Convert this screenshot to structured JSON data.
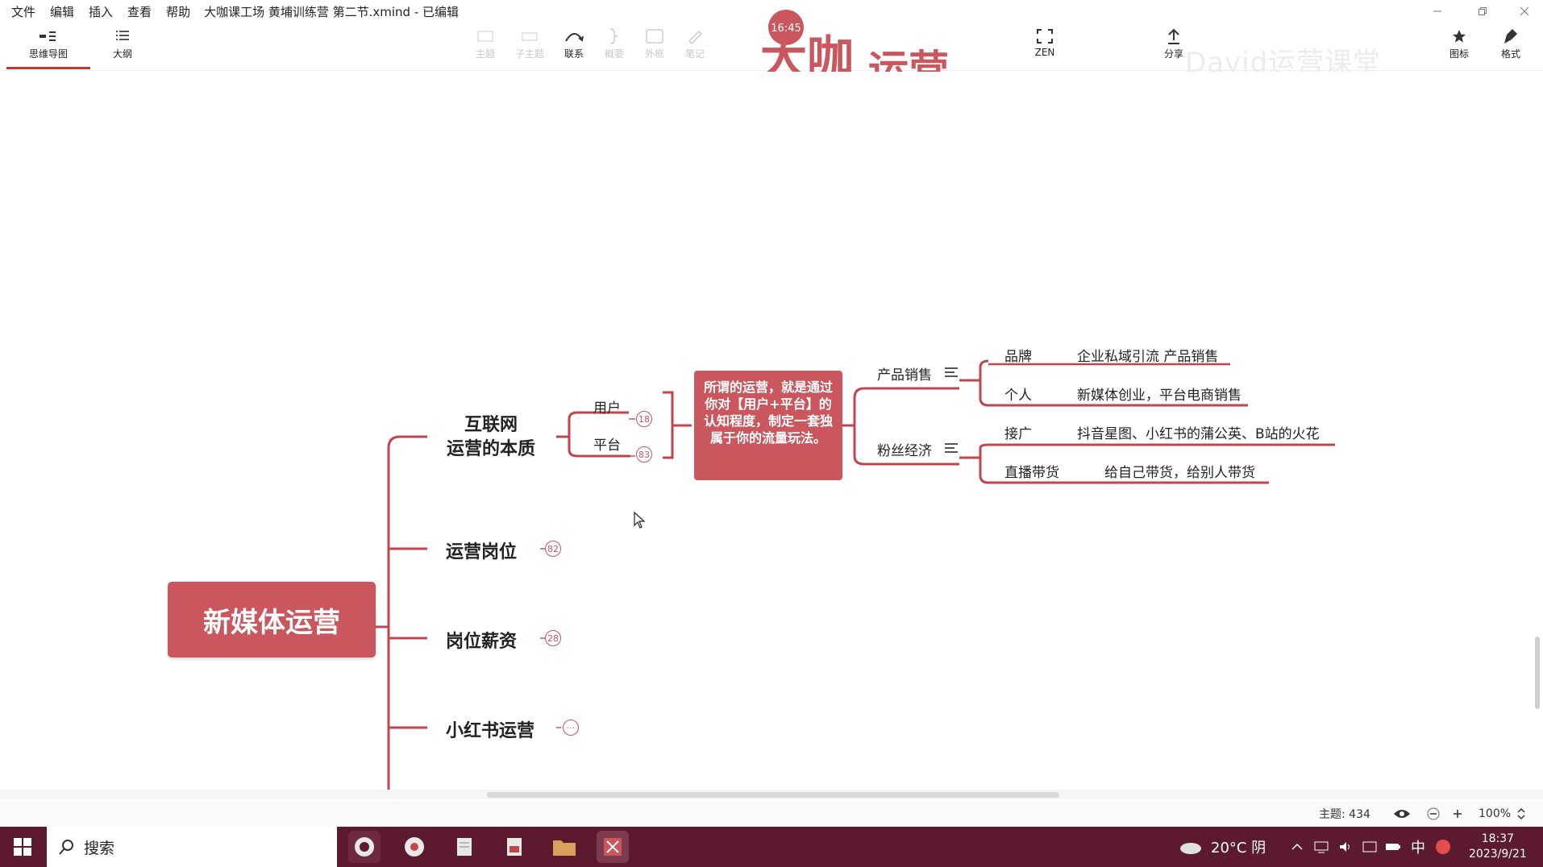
{
  "menubar": {
    "items": [
      "文件",
      "编辑",
      "插入",
      "查看",
      "帮助"
    ],
    "doc_title": "大咖课工场 黄埔训练营 第二节.xmind - 已编辑"
  },
  "toolbar": {
    "mindmap": "思维导图",
    "outline": "大纲",
    "topic": "主题",
    "subtopic": "子主题",
    "relationship": "联系",
    "summary": "概要",
    "boundary": "外框",
    "note": "笔记",
    "zen": "ZEN",
    "share": "分享",
    "icon_panel": "图标",
    "format": "格式"
  },
  "overlay": {
    "logo_time": "16:45",
    "logo_line1": "大咖",
    "logo_line2": "运营",
    "watermark": "David运营课堂"
  },
  "mindmap": {
    "central": "新媒体运营",
    "topic1_line1": "互联网",
    "topic1_line2": "运营的本质",
    "user": "用户",
    "platform": "平台",
    "badge_user": "18",
    "badge_platform": "83",
    "callout": "所谓的运营，就是通过你对【用户+平台】的认知程度，制定一套独属于你的流量玩法。",
    "product_sales": "产品销售",
    "fan_economy": "粉丝经济",
    "brand": "品牌",
    "brand_desc": "企业私域引流 产品销售",
    "personal": "个人",
    "personal_desc": "新媒体创业，平台电商销售",
    "ads": "接广",
    "ads_desc": "抖音星图、小红书的蒲公英、B站的火花",
    "live": "直播带货",
    "live_desc": "给自己带货，给别人带货",
    "topic2": "运营岗位",
    "badge_topic2": "82",
    "topic3": "岗位薪资",
    "badge_topic3": "28",
    "topic4": "小红书运营",
    "badge_topic4": "···"
  },
  "statusbar": {
    "topic_count": "主题: 434",
    "zoom": "100%"
  },
  "taskbar": {
    "search": "搜索",
    "weather": "20°C 阴",
    "ime": "中",
    "time": "18:37",
    "date": "2023/9/21"
  },
  "colors": {
    "accent": "#c9575d",
    "branch": "#c0454f",
    "taskbar": "#5c1a2e"
  }
}
